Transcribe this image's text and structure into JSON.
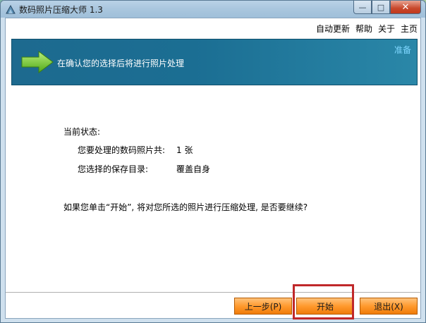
{
  "window": {
    "title": "数码照片压缩大师 1.3",
    "controls": {
      "minimize": "—",
      "maximize": "□",
      "close": "✕"
    }
  },
  "menu": {
    "items": [
      "自动更新",
      "帮助",
      "关于",
      "主页"
    ]
  },
  "banner": {
    "message": "在确认您的选择后将进行照片处理",
    "step": "准备"
  },
  "status": {
    "heading": "当前状态:",
    "photo_count_label": "您要处理的数码照片共:",
    "photo_count_value": "1 张",
    "save_dir_label": "您选择的保存目录:",
    "save_dir_value": "覆盖自身"
  },
  "confirm": {
    "text": "如果您单击“开始”, 将对您所选的照片进行压缩处理, 是否要继续?"
  },
  "buttons": {
    "prev": "上一步(P)",
    "start": "开始",
    "exit": "退出(X)"
  },
  "colors": {
    "banner": "#1b6e93",
    "button_orange": "#ff9a2e",
    "highlight": "#c0282a"
  }
}
